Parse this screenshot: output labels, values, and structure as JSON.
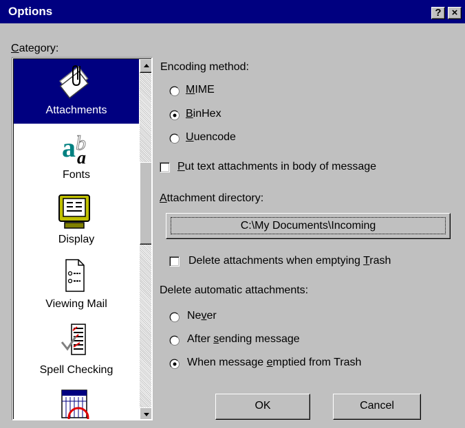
{
  "window": {
    "title": "Options",
    "help_glyph": "?",
    "close_glyph": "×"
  },
  "category": {
    "label_accel": "C",
    "label_rest": "ategory:",
    "items": [
      {
        "label": "Attachments",
        "icon": "paperclip-document-icon",
        "selected": true
      },
      {
        "label": "Fonts",
        "icon": "fonts-icon",
        "selected": false
      },
      {
        "label": "Display",
        "icon": "monitor-icon",
        "selected": false
      },
      {
        "label": "Viewing Mail",
        "icon": "mail-list-icon",
        "selected": false
      },
      {
        "label": "Spell Checking",
        "icon": "spell-check-icon",
        "selected": false
      },
      {
        "label": "",
        "icon": "calendar-clock-icon",
        "selected": false
      }
    ]
  },
  "encoding": {
    "label": "Encoding method:",
    "options": [
      {
        "accel": "M",
        "rest": "IME",
        "checked": false
      },
      {
        "accel": "B",
        "rest": "inHex",
        "checked": true
      },
      {
        "accel": "U",
        "rest": "uencode",
        "checked": false
      }
    ]
  },
  "put_text": {
    "accel": "P",
    "rest": "ut text attachments in body of message",
    "checked": false
  },
  "attachment_dir": {
    "label_accel": "A",
    "label_rest": "ttachment directory:",
    "value": "C:\\My Documents\\Incoming"
  },
  "delete_on_trash": {
    "before": "Delete attachments when emptying ",
    "accel": "T",
    "after": "rash",
    "checked": false
  },
  "delete_auto": {
    "label": "Delete automatic attachments:",
    "options": [
      {
        "before": "Ne",
        "accel": "v",
        "after": "er",
        "checked": false
      },
      {
        "before": "After ",
        "accel": "s",
        "after": "ending message",
        "checked": false
      },
      {
        "before": "When message ",
        "accel": "e",
        "after": "mptied from Trash",
        "checked": true
      }
    ]
  },
  "buttons": {
    "ok": "OK",
    "cancel": "Cancel"
  }
}
